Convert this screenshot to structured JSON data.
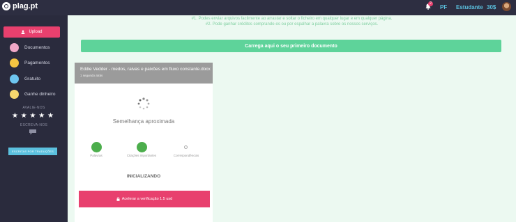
{
  "header": {
    "logo_text": "plag.pt",
    "notification_count": "2",
    "links": [
      "PF",
      "Estudante",
      "30$"
    ]
  },
  "sidebar": {
    "upload_label": "Upload",
    "items": [
      {
        "label": "Documentos",
        "icon": "documents-icon",
        "color": "#f0a8c8"
      },
      {
        "label": "Pagamentos",
        "icon": "payments-icon",
        "color": "#f5c542"
      },
      {
        "label": "Gratuito",
        "icon": "free-icon",
        "color": "#6ec6f0"
      },
      {
        "label": "Ganhe dinheiro",
        "icon": "money-icon",
        "color": "#f5d76e"
      }
    ],
    "rate_label": "AVALIE-NOS",
    "stars": [
      "★",
      "★",
      "★",
      "★",
      "★"
    ],
    "write_label": "ESCREVA-NOS",
    "translations_button": "ESCRITAS POR TRADUÇÕES"
  },
  "main": {
    "hint_1": "#1. Podes enviar arquivos facilmente ao arrastar e soltar o ficheiro em qualquer lugar e em qualquer página.",
    "hint_2": "#2. Pode ganhar créditos comprando-os ou por espalhar a palavra sobre os nossos serviços.",
    "first_doc_button": "Carrega aqui o seu primeiro documento",
    "card": {
      "title": "Eddie Vedder - medos, raivas e paixões em fluxo constante.docx",
      "time": "1 segundo atrás",
      "similarity_label": "Semelhança aproximada",
      "metrics": [
        {
          "label": "Palavras",
          "state": "done"
        },
        {
          "label": "Citações importantes",
          "state": "done"
        },
        {
          "label": "Correspondências",
          "state": "pending"
        }
      ],
      "status": "INICIALIZANDO",
      "speed_button": "Acelerar a verificação 1.5 usd"
    }
  },
  "colors": {
    "accent_pink": "#e8406e",
    "accent_green": "#5ed39a",
    "accent_blue": "#5bc0de",
    "sidebar_bg": "#2a2b3d"
  }
}
